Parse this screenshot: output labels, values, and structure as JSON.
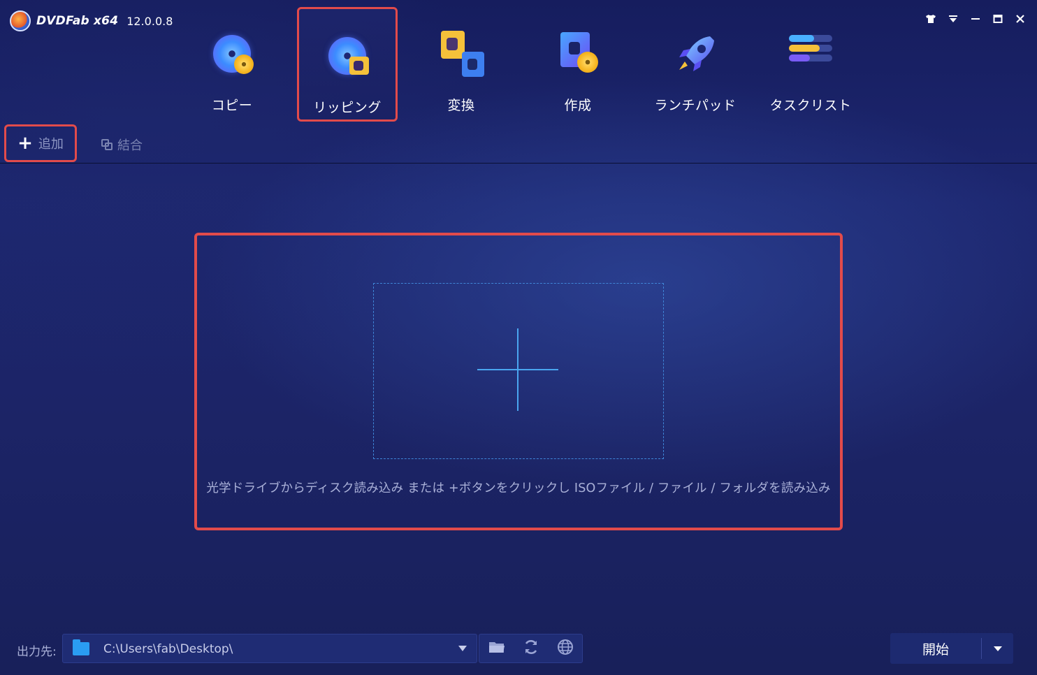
{
  "app": {
    "brand": "DVDFab x64",
    "version": "12.0.0.8"
  },
  "window_controls": [
    "shirt-icon",
    "dropdown-icon",
    "minimize-icon",
    "maximize-icon",
    "close-icon"
  ],
  "nav": {
    "items": [
      {
        "label": "コピー",
        "icon": "copy-disc-icon",
        "active": false
      },
      {
        "label": "リッピング",
        "icon": "ripper-disc-icon",
        "active": true
      },
      {
        "label": "変換",
        "icon": "convert-film-icon",
        "active": false
      },
      {
        "label": "作成",
        "icon": "creator-film-icon",
        "active": false
      },
      {
        "label": "ランチパッド",
        "icon": "rocket-icon",
        "active": false
      },
      {
        "label": "タスクリスト",
        "icon": "tasklist-icon",
        "active": false
      }
    ]
  },
  "toolbar": {
    "add_label": "追加",
    "merge_label": "結合"
  },
  "dropzone": {
    "hint": "光学ドライブからディスク読み込み または +ボタンをクリックし ISOファイル / ファイル / フォルダを読み込み"
  },
  "bottom": {
    "output_label": "出力先:",
    "path": "C:\\Users\\fab\\Desktop\\",
    "start_label": "開始"
  },
  "colors": {
    "highlight": "#e24b4b",
    "accent": "#4aa6f0",
    "background": "#1c2467"
  }
}
